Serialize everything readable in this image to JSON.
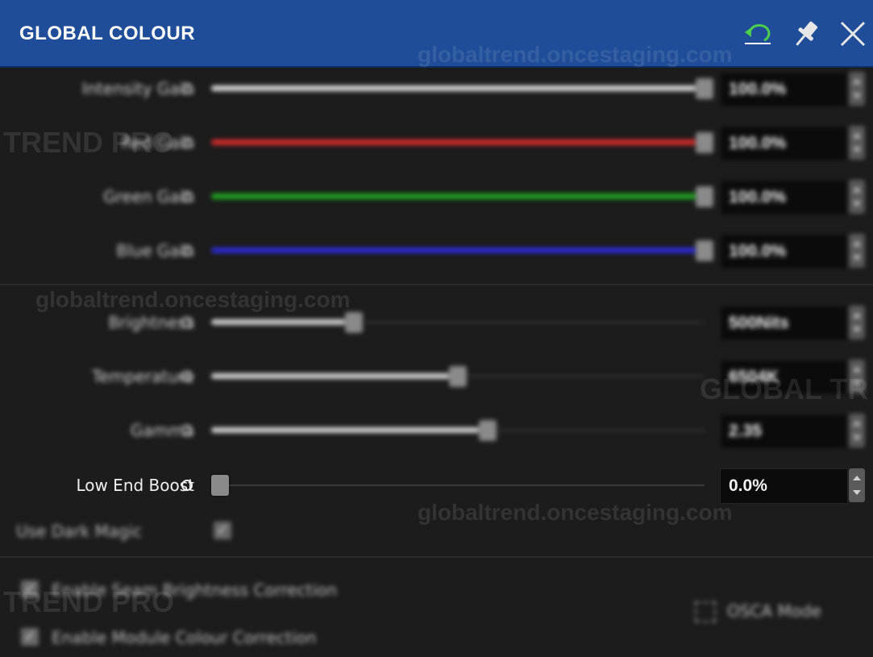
{
  "window": {
    "title": "GLOBAL COLOUR"
  },
  "titlebar_icons": [
    "undo-icon",
    "pin-icon",
    "close-icon"
  ],
  "colors": {
    "titlebar": "#1f4d99",
    "intensity": "#d9d9d9",
    "red": "#d62b2b",
    "green": "#1fa81f",
    "blue": "#2b2bd6",
    "neutral": "#d0d0d0"
  },
  "sliders": [
    {
      "label": "Intensity Gain",
      "value_text": "100.0%",
      "fraction": 1.0
    },
    {
      "label": "Red Gain",
      "value_text": "100.0%",
      "fraction": 1.0
    },
    {
      "label": "Green Gain",
      "value_text": "100.0%",
      "fraction": 1.0
    },
    {
      "label": "Blue Gain",
      "value_text": "100.0%",
      "fraction": 1.0
    },
    {
      "label": "Brightness",
      "value_text": "500Nits",
      "fraction": 0.29
    },
    {
      "label": "Temperature",
      "value_text": "6504K",
      "fraction": 0.5
    },
    {
      "label": "Gamma",
      "value_text": "2.35",
      "fraction": 0.56
    },
    {
      "label": "Low End Boost",
      "value_text": "0.0%",
      "fraction": 0.0
    }
  ],
  "checkboxes": {
    "dark_magic": {
      "label": "Use Dark Magic",
      "checked": true
    },
    "seam_brightness": {
      "label": "Enable Seam Brightness Correction",
      "checked": true
    },
    "module_colour": {
      "label": "Enable Module Colour Correction",
      "checked": true
    }
  },
  "osca": {
    "label": "OSCA Mode"
  },
  "watermarks": {
    "site": "globaltrend.oncestaging.com",
    "brand1": "TREND PRO",
    "brand2": "GLOBAL TR"
  }
}
